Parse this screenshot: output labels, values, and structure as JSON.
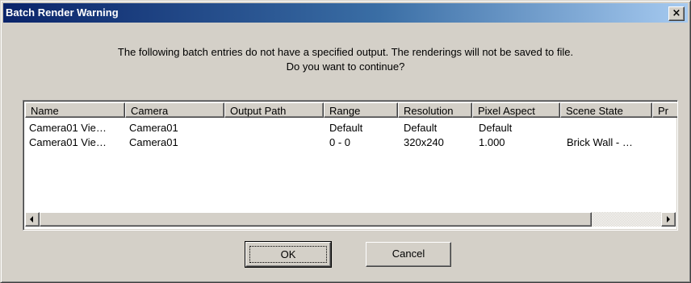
{
  "window": {
    "title": "Batch Render Warning",
    "close_glyph": "×",
    "close_icon": "close-icon"
  },
  "message": {
    "line1": "The following batch entries do not have a specified output. The renderings will not be saved to file.",
    "line2": "Do you want to continue?"
  },
  "list": {
    "columns": [
      "Name",
      "Camera",
      "Output Path",
      "Range",
      "Resolution",
      "Pixel Aspect",
      "Scene State",
      "Pr"
    ],
    "rows": [
      [
        "Camera01 Vie…",
        "Camera01",
        "",
        "Default",
        "Default",
        "Default",
        ""
      ],
      [
        "Camera01 Vie…",
        "Camera01",
        "",
        "0 - 0",
        "320x240",
        "1.000",
        "Brick Wall - …"
      ]
    ]
  },
  "scrollbar": {
    "left_icon": "scroll-left-arrow-icon",
    "right_icon": "scroll-right-arrow-icon"
  },
  "buttons": {
    "ok": "OK",
    "cancel": "Cancel"
  },
  "colors": {
    "title_gradient_start": "#0a246a",
    "title_gradient_end": "#a6caf0",
    "face": "#d4d0c8"
  }
}
